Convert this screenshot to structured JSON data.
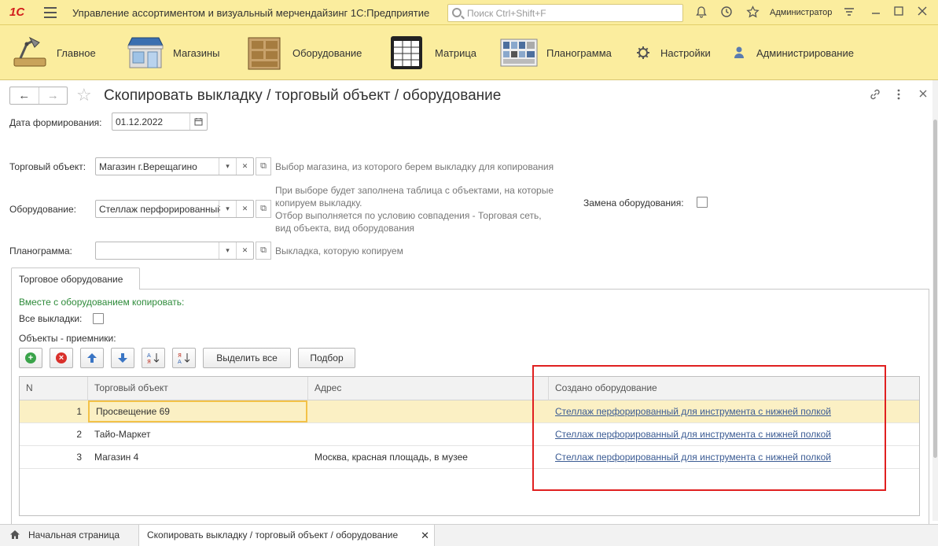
{
  "app": {
    "logo": "1С",
    "title": "Управление ассортиментом  и визуальный мерчендайзинг 1С:Предприятие",
    "search_placeholder": "Поиск Ctrl+Shift+F",
    "user": "Администратор"
  },
  "sections": [
    {
      "label": "Главное",
      "icon": "desk-lamp-icon"
    },
    {
      "label": "Магазины",
      "icon": "store-icon"
    },
    {
      "label": "Оборудование",
      "icon": "shelving-icon"
    },
    {
      "label": "Матрица",
      "icon": "matrix-grid-icon"
    },
    {
      "label": "Планограмма",
      "icon": "planogram-icon"
    },
    {
      "label": "Настройки",
      "icon": "gear-icon"
    },
    {
      "label": "Администрирование",
      "icon": "person-icon"
    }
  ],
  "form": {
    "title": "Скопировать выкладку / торговый объект / оборудование",
    "date_label": "Дата формирования:",
    "date_value": "01.12.2022",
    "store_label": "Торговый объект:",
    "store_value": "Магазин г.Верещагино",
    "store_hint": "Выбор магазина, из которого берем выкладку для копирования",
    "equipment_label": "Оборудование:",
    "equipment_value": "Стеллаж перфорированный",
    "equipment_hint_1": "При выборе будет заполнена таблица с объектами, на которые",
    "equipment_hint_2": "копируем выкладку.",
    "equipment_hint_3": "Отбор выполняется по условию совпадения - Торговая сеть,",
    "equipment_hint_4": "вид объекта, вид оборудования",
    "replace_label": "Замена оборудования:",
    "planogram_label": "Планограмма:",
    "planogram_value": "",
    "planogram_hint": "Выкладка, которую копируем"
  },
  "tab": {
    "label": "Торговое оборудование",
    "copy_with": "Вместе с оборудованием копировать:",
    "all_layouts_label": "Все выкладки:",
    "receivers_label": "Объекты - приемники:",
    "select_all": "Выделить все",
    "pick": "Подбор"
  },
  "table": {
    "columns": [
      "N",
      "Торговый объект",
      "Адрес",
      "Создано оборудование"
    ],
    "rows": [
      {
        "n": "1",
        "object": "Просвещение 69",
        "address": "",
        "created": "Стеллаж перфорированный для инструмента с нижней полкой"
      },
      {
        "n": "2",
        "object": "Тайо-Маркет",
        "address": "",
        "created": "Стеллаж перфорированный для инструмента с нижней полкой"
      },
      {
        "n": "3",
        "object": "Магазин 4",
        "address": "Москва, красная площадь, в музее",
        "created": "Стеллаж перфорированный для инструмента с нижней полкой"
      }
    ]
  },
  "bottom": {
    "home": "Начальная страница",
    "current": "Скопировать выкладку / торговый объект / оборудование"
  },
  "colors": {
    "topbar": "#fbed9e",
    "highlight_box": "#e02020",
    "selected_row": "#fbf0c4",
    "link": "#3c5c94"
  }
}
